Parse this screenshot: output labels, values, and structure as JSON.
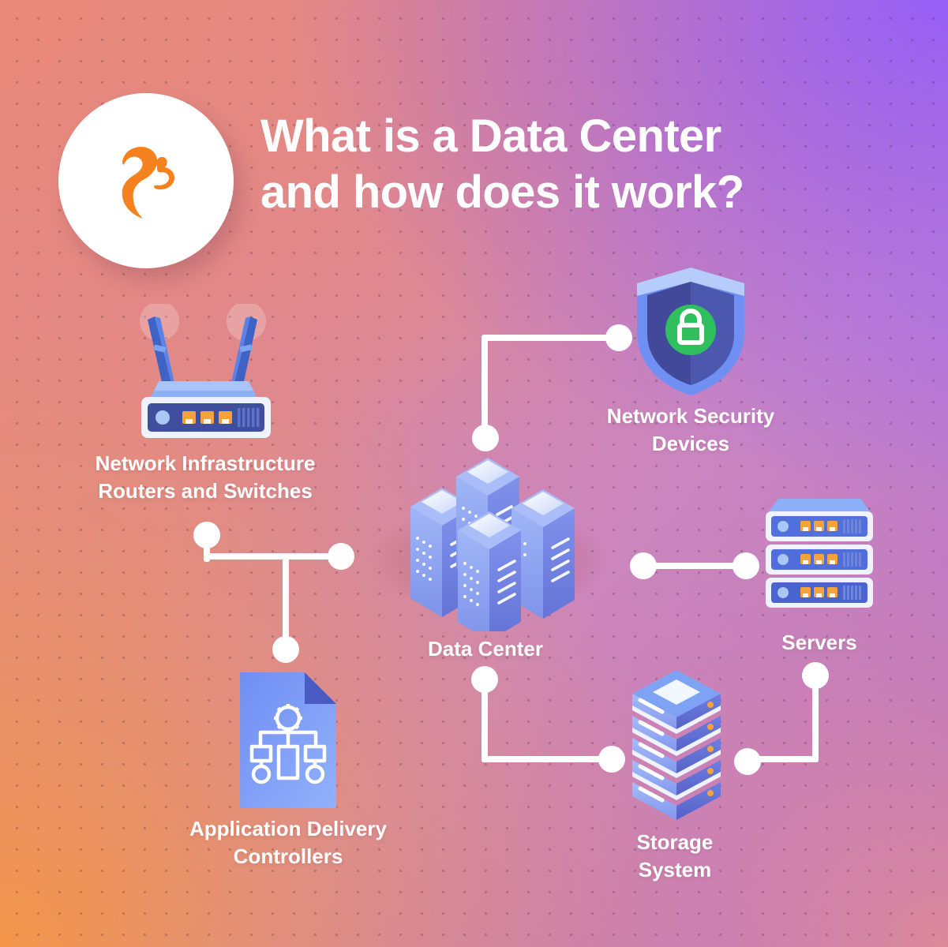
{
  "page": {
    "title_line1": "What is a Data Center",
    "title_line2": "and how does it work?",
    "background": {
      "top_right": "#9966f5",
      "bottom_left": "#f2964b",
      "bottom_right": "#dd8a92",
      "top_left": "#e8887c"
    }
  },
  "logo": {
    "name": "squirrel-logo",
    "mark_color": "#f5821f",
    "circle_color": "#ffffff"
  },
  "nodes": [
    {
      "id": "network-infrastructure",
      "icon": "router-icon",
      "label": "Network Infrastructure\nRouters and Switches"
    },
    {
      "id": "network-security",
      "icon": "shield-lock-icon",
      "label": "Network Security\nDevices"
    },
    {
      "id": "data-center",
      "icon": "data-center-icon",
      "label": "Data Center"
    },
    {
      "id": "servers",
      "icon": "server-stack-icon",
      "label": "Servers"
    },
    {
      "id": "application-delivery-controllers",
      "icon": "document-flowchart-icon",
      "label": "Application Delivery\nControllers"
    },
    {
      "id": "storage-system",
      "icon": "storage-tower-icon",
      "label": "Storage\nSystem"
    }
  ],
  "palette": {
    "connector": "#ffffff",
    "icon_blue_light": "#7e9cf5",
    "icon_blue": "#5b79e8",
    "icon_blue_dark": "#4457b8",
    "icon_navy": "#3b4a9e",
    "port_orange": "#f2a33c",
    "lock_green": "#2fbf5f",
    "shield_outer": "#6f8ff2",
    "shield_inner": "#43499a"
  }
}
